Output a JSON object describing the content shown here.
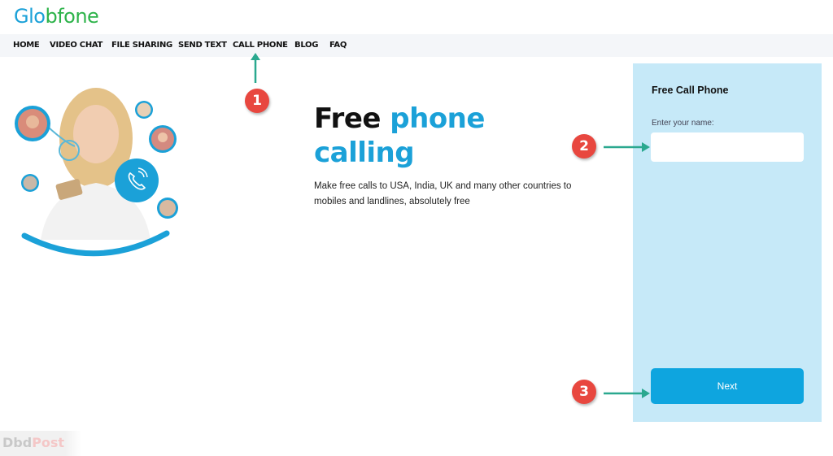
{
  "header": {
    "logo_part1": "Glo",
    "logo_part2": "bfone"
  },
  "nav": {
    "items": [
      {
        "label": "HOME"
      },
      {
        "label": "VIDEO CHAT"
      },
      {
        "label": "FILE SHARING"
      },
      {
        "label": "SEND TEXT"
      },
      {
        "label": "CALL PHONE"
      },
      {
        "label": "BLOG"
      },
      {
        "label": "FAQ"
      }
    ]
  },
  "hero": {
    "headline_dark": "Free ",
    "headline_blue_1": "phone",
    "headline_blue_2": "calling",
    "description": "Make free calls to USA, India, UK and many other countries to mobiles and landlines, absolutely free",
    "phone_icon": "phone-call-icon"
  },
  "form": {
    "title": "Free Call Phone",
    "name_label": "Enter your name:",
    "name_value": "",
    "name_placeholder": "",
    "next_label": "Next"
  },
  "annotations": {
    "step1": "1",
    "step2": "2",
    "step3": "3"
  },
  "watermark": {
    "part1": "Dbd",
    "part2": "Post"
  },
  "colors": {
    "brand_blue": "#1ba1d8",
    "brand_green": "#2db34a",
    "panel_bg": "#c6e9f8",
    "button_bg": "#0ea5df",
    "badge_red": "#e8473f",
    "arrow_teal": "#2aa88f"
  }
}
